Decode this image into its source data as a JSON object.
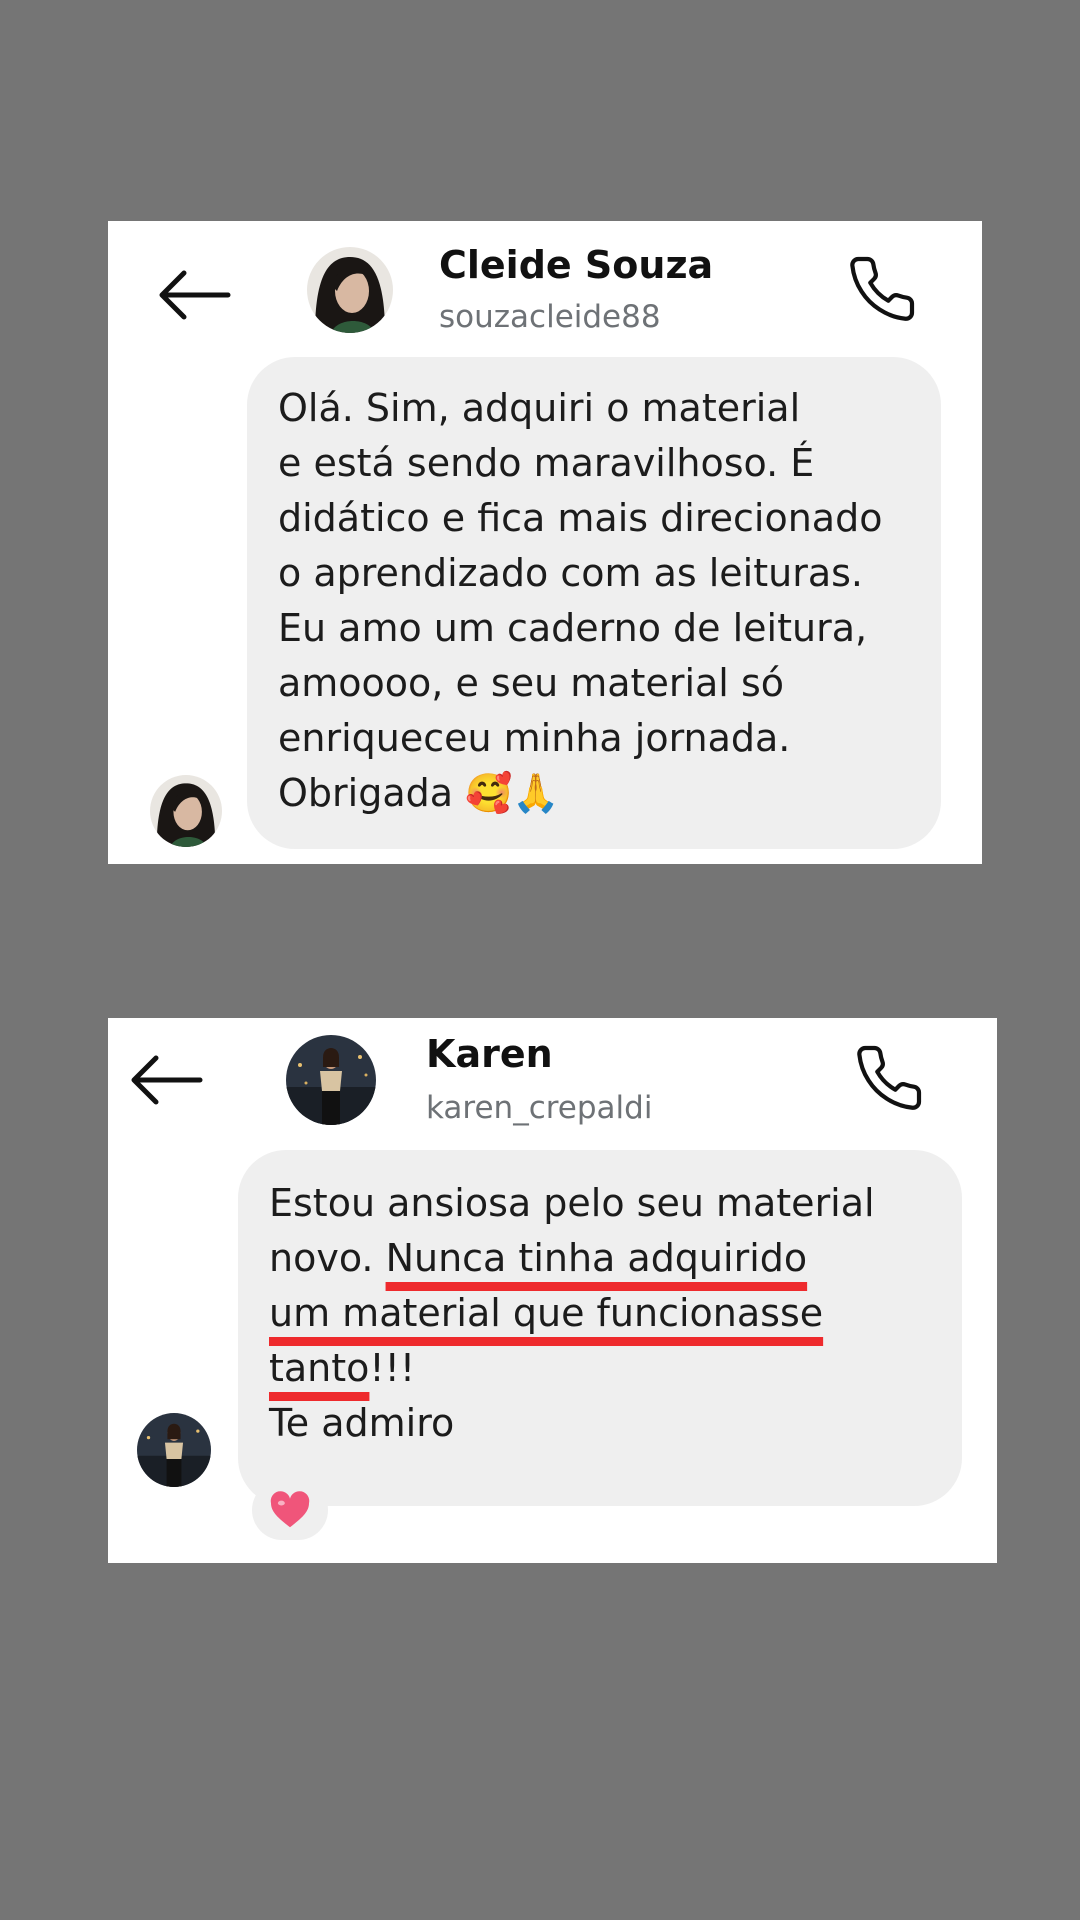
{
  "conversations": [
    {
      "contact_name": "Cleide Souza",
      "contact_handle": "souzacleide88",
      "back_icon": "arrow-left-icon",
      "call_icon": "phone-icon",
      "message_lines": [
        "Olá. Sim, adquiri o material",
        "e está sendo maravilhoso.  É",
        "didático e fica mais direcionado",
        "o aprendizado com as leituras.",
        "Eu amo um caderno de leitura,",
        "amoooo, e seu material só",
        "enriqueceu minha jornada.",
        "Obrigada 🥰🙏"
      ]
    },
    {
      "contact_name": "Karen",
      "contact_handle": "karen_crepaldi",
      "back_icon": "arrow-left-icon",
      "call_icon": "phone-icon",
      "message": {
        "line1": "Estou ansiosa pelo seu material",
        "line2_plain": "novo. ",
        "line2_underlined": "Nunca tinha adquirido",
        "line3_underlined": "um material que funcionasse",
        "line4_underlined": "tanto",
        "line4_plain": "!!!",
        "line5": "Te admiro"
      },
      "reaction": "heart-icon",
      "underline_color": "#ee2a2d"
    }
  ],
  "colors": {
    "background": "#757575",
    "card": "#ffffff",
    "bubble": "#efefef",
    "heart": "#f0557a"
  }
}
